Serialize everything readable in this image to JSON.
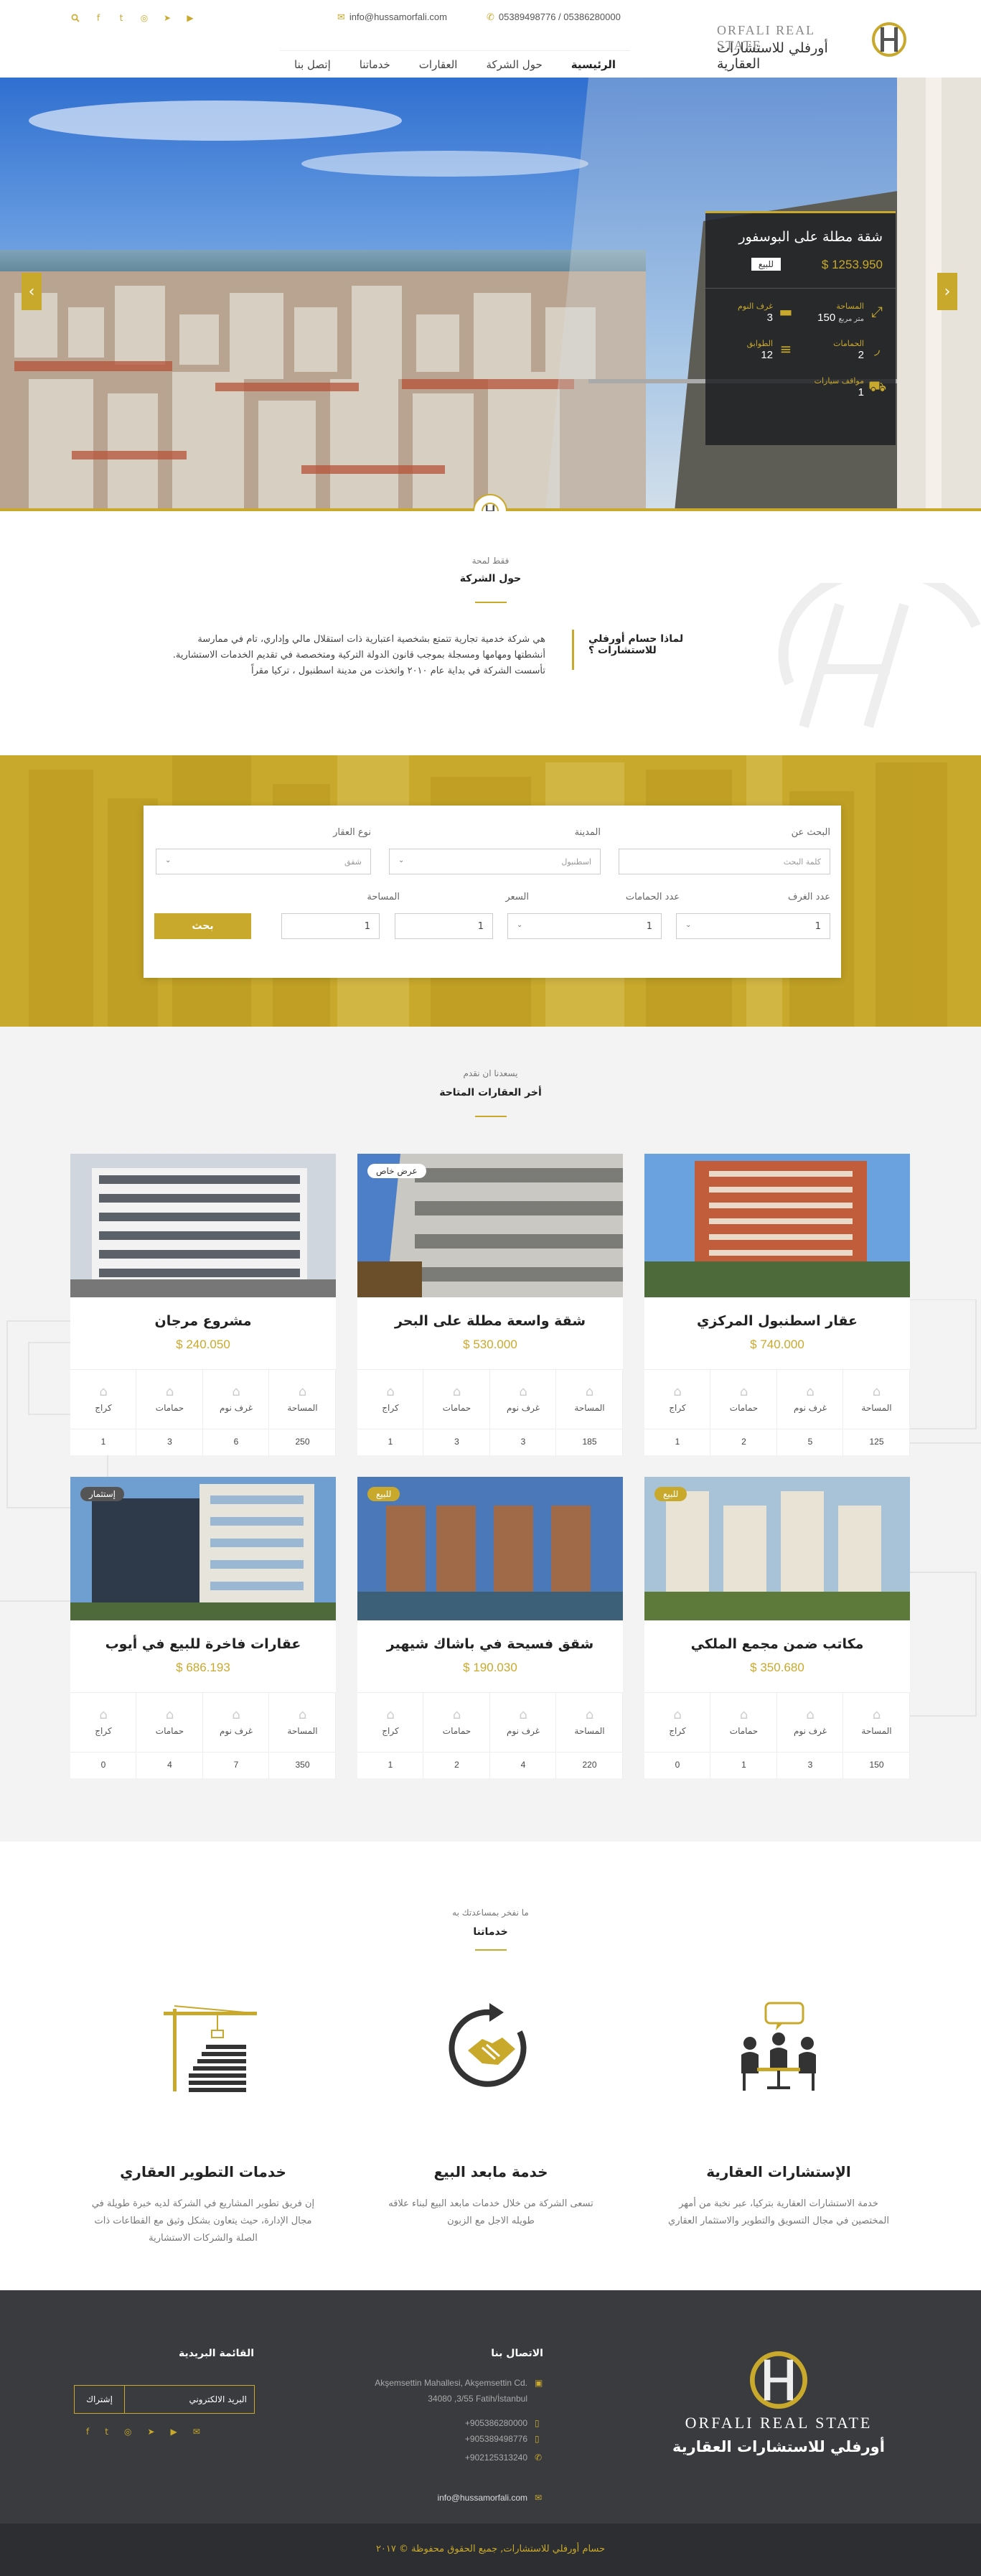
{
  "header": {
    "email": "info@hussamorfali.com",
    "phones": "05389498776 / 05386280000",
    "brand_en": "ORFALI REAL STATE",
    "brand_ar": "أورفلي للاستشارات العقارية",
    "social": [
      "search-icon",
      "facebook-icon",
      "twitter-icon",
      "instagram-icon",
      "telegram-icon",
      "youtube-icon"
    ],
    "nav": [
      "الرئيسية",
      "حول الشركة",
      "العقارات",
      "خدماتنا",
      "إتصل بنا"
    ]
  },
  "hero": {
    "title": "شقة مطلة على البوسفور",
    "price": "$ 1253.950",
    "status": "للبيع",
    "features": [
      {
        "label": "المساحة",
        "value": "150",
        "unit": "متر مربع",
        "icon": "area-icon"
      },
      {
        "label": "غرف النوم",
        "value": "3",
        "icon": "bed-icon"
      },
      {
        "label": "الحمامات",
        "value": "2",
        "icon": "bath-icon"
      },
      {
        "label": "الطوابق",
        "value": "12",
        "icon": "floors-icon"
      },
      {
        "label": "مواقف سيارات",
        "value": "1",
        "icon": "car-icon"
      }
    ]
  },
  "about": {
    "sub": "فقط لمحة",
    "title": "حول الشركة",
    "question": "لماذا حسام أورفلي للاستشارات ؟",
    "text": "هي شركة خدمية تجارية تتمتع بشخصية اعتبارية ذات استقلال مالي وإداري، تام في ممارسة أنشطتها ومهامها ومسجلة بموجب قانون الدولة التركية ومتخصصة في تقديم الخدمات الاستشارية. تأسست الشركة في بداية عام ٢٠١٠ واتخذت من مدينة اسطنبول ، تركيا مقراً"
  },
  "search": {
    "labels": {
      "keyword": "البحث عن",
      "city": "المدينة",
      "type": "نوع العقار",
      "rooms": "عدد الغرف",
      "baths": "عدد الحمامات",
      "price": "السعر",
      "area": "المساحة"
    },
    "keyword_placeholder": "كلمة البحث",
    "city_value": "اسطنبول",
    "type_value": "شقق",
    "rooms_value": "1",
    "baths_value": "1",
    "price_value": "1",
    "area_value": "1",
    "button": "بحث"
  },
  "listings": {
    "sub": "يسعدنا ان نقدم",
    "title": "أخر العقارات المتاحة",
    "feature_labels": [
      "كراج",
      "حمامات",
      "غرف نوم",
      "المساحة"
    ],
    "cards": [
      {
        "title": "عقار اسطنبول المركزي",
        "price": "$ 740.000",
        "vals": [
          "1",
          "2",
          "5",
          "125"
        ],
        "tag": ""
      },
      {
        "title": "شقة واسعة مطلة على البحر",
        "price": "$ 530.000",
        "vals": [
          "1",
          "3",
          "3",
          "185"
        ],
        "tag": "عرض خاص"
      },
      {
        "title": "مشروع مرجان",
        "price": "$ 240.050",
        "vals": [
          "1",
          "3",
          "6",
          "250"
        ],
        "tag": ""
      },
      {
        "title": "مكاتب ضمن مجمع الملكي",
        "price": "$ 350.680",
        "vals": [
          "0",
          "1",
          "3",
          "150"
        ],
        "tag": "للبيع"
      },
      {
        "title": "شقق فسيحة في باشاك شيهير",
        "price": "$ 190.030",
        "vals": [
          "1",
          "2",
          "4",
          "220"
        ],
        "tag": "للبيع"
      },
      {
        "title": "عقارات فاخرة للبيع في أيوب",
        "price": "$ 686.193",
        "vals": [
          "0",
          "4",
          "7",
          "350"
        ],
        "tag": "إستثمار"
      }
    ]
  },
  "services": {
    "sub": "ما نفخر بمساعدتك به",
    "title": "خدماتنا",
    "items": [
      {
        "title": "الإستشارات العقارية",
        "text": "خدمة الاستشارات العقارية بتركيا، عبر نخبة من أمهر المختصين في مجال التسويق والتطوير والاستثمار العقاري",
        "icon": "meeting-icon"
      },
      {
        "title": "خدمة مابعد البيع",
        "text": "تسعى الشركة من خلال خدمات مابعد البيع لبناء علاقه طويله الاجل مع الزبون",
        "icon": "handshake-icon"
      },
      {
        "title": "خدمات التطوير العقاري",
        "text": "إن فريق تطوير المشاريع في الشركة لديه خبرة طويلة في مجال الإدارة، حيث يتعاون بشكل وثيق مع القطاعات ذات الصلة والشركات الاستشارية",
        "icon": "construction-icon"
      }
    ]
  },
  "footer": {
    "brand_en": "ORFALI REAL STATE",
    "brand_ar": "أورفلي للاستشارات العقارية",
    "contact_title": "الاتصال بنا",
    "address": "Akşemsettin Mahallesi, Akşemsettin Cd.",
    "address2": "34080 ,3/55 Fatih/İstanbul",
    "phone1": "+905386280000",
    "phone2": "+905389498776",
    "phone3": "+902125313240",
    "email": "info@hussamorfali.com",
    "newsletter_title": "القائمة البريدية",
    "newsletter_placeholder": "البريد الالكتروني",
    "newsletter_button": "إشتراك",
    "copyright": "حسام أورفلي للاستشارات, جميع الحقوق محفوظة © ٢٠١٧"
  },
  "colors": {
    "accent": "#c9a92c",
    "dark": "#3a3b3e",
    "darker": "#2d2e31"
  }
}
